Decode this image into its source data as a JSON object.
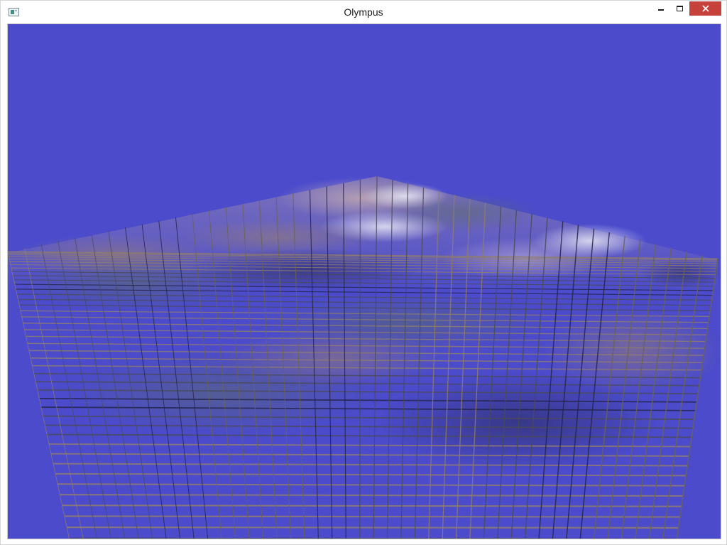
{
  "window": {
    "title": "Olympus"
  },
  "colors": {
    "sky": "#4b4bcc",
    "close_button": "#c7413b",
    "grid_dark": "#1a1a3a",
    "grid_light": "#8a7a6a"
  },
  "icons": {
    "app": "app-window-icon",
    "minimize": "minimize-icon",
    "maximize": "maximize-icon",
    "close": "close-icon"
  }
}
